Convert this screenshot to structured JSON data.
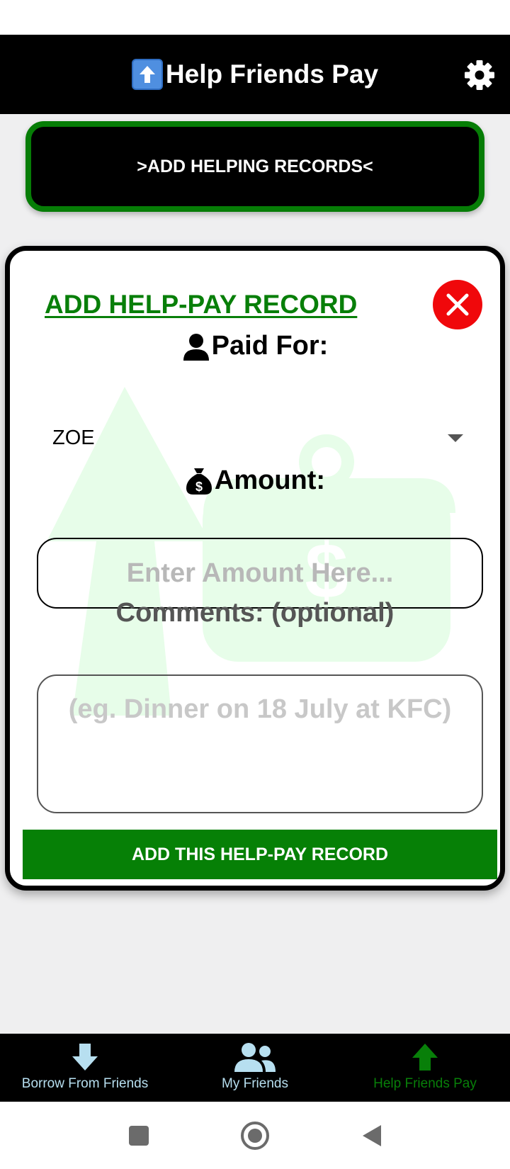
{
  "header": {
    "title": "Help Friends Pay",
    "emoji_icon": "up-arrow-emoji-icon",
    "settings_icon": "gear-icon"
  },
  "add_records_button": {
    "label": ">ADD HELPING RECORDS<"
  },
  "modal": {
    "title": "ADD HELP-PAY RECORD",
    "paid_for_label": "Paid For:",
    "paid_for_value": "ZOE",
    "amount_label": "Amount:",
    "amount_placeholder": "Enter Amount Here...",
    "comments_label": "Comments: (optional)",
    "comments_placeholder": "(eg. Dinner on 18 July at KFC)",
    "submit_label": "ADD THIS HELP-PAY RECORD"
  },
  "bottom_nav": {
    "items": [
      {
        "label": "Borrow From Friends",
        "icon": "down-arrow-icon"
      },
      {
        "label": "My Friends",
        "icon": "users-icon"
      },
      {
        "label": "Help Friends Pay",
        "icon": "up-arrow-icon",
        "active": true
      }
    ]
  },
  "colors": {
    "accent_green": "#087f09",
    "close_red": "#f0080b",
    "nav_inactive": "#b7dff0",
    "watermark_green": "#e7fde9"
  }
}
